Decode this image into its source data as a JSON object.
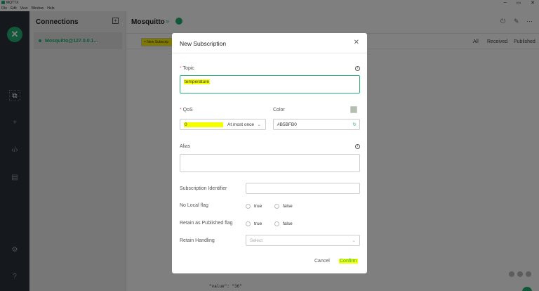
{
  "window": {
    "title": "MQTTX",
    "min": "–",
    "max": "▭",
    "close": "✕"
  },
  "menu": [
    "File",
    "Edit",
    "View",
    "Window",
    "Help"
  ],
  "rail": {
    "logo": "✕",
    "icons": [
      "copy-icon",
      "plus-icon",
      "code-icon",
      "log-icon",
      "gear-icon",
      "help-icon"
    ]
  },
  "sidebar": {
    "title": "Connections",
    "add": "+",
    "connection": "Mosquitto@127.0.0.1..."
  },
  "main": {
    "name": "Mosquitto",
    "chevron": "»",
    "new_subscription_btn": "+ New Subscrip",
    "filters": [
      "All",
      "Received",
      "Published"
    ],
    "payload": "\"value\": \"36\""
  },
  "dialog": {
    "title": "New Subscription",
    "close": "✕",
    "topic": {
      "label": "Topic",
      "value": "temperature"
    },
    "qos": {
      "label": "QoS",
      "value": "0",
      "desc": "At most once"
    },
    "color": {
      "label": "Color",
      "value": "#B5BFB0",
      "swatch": "#B5BFB0"
    },
    "alias": {
      "label": "Alias",
      "value": ""
    },
    "sub_id": {
      "label": "Subscription Identifier",
      "value": ""
    },
    "no_local": {
      "label": "No Local flag",
      "opt1": "true",
      "opt2": "false"
    },
    "retain_pub": {
      "label": "Retain as Published flag",
      "opt1": "true",
      "opt2": "false"
    },
    "retain_handling": {
      "label": "Retain Handling",
      "placeholder": "Select"
    },
    "cancel": "Cancel",
    "confirm": "Confirm"
  },
  "colors": {
    "accent": "#23b075",
    "rail": "#2b323d",
    "highlight": "#f5ff00"
  }
}
